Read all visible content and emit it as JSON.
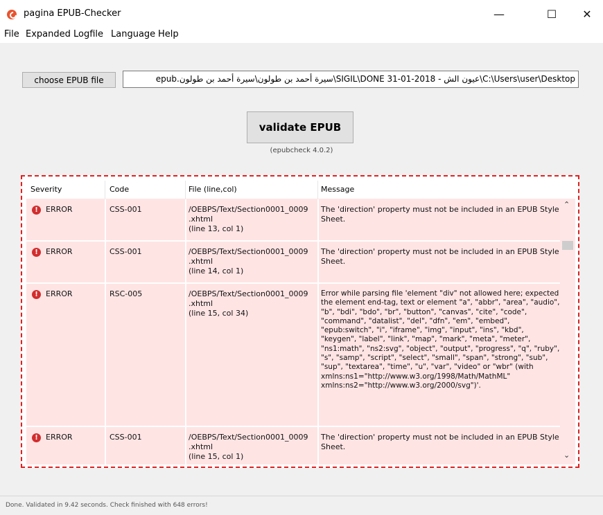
{
  "window": {
    "title": "pagina EPUB-Checker"
  },
  "menu": [
    "File",
    "Expanded",
    "Logfile",
    "Language",
    "Help"
  ],
  "choose_button": "choose EPUB file",
  "path_value": "C:\\Users\\user\\Desktop\\عيون الش - SIGIL\\DONE 31-01-2018\\سيرة أحمد بن طولون\\سيرة أحمد بن طولون.epub",
  "validate_button": "validate EPUB",
  "version": "(epubcheck 4.0.2)",
  "table": {
    "columns": [
      "Severity",
      "Code",
      "File (line,col)",
      "Message"
    ],
    "rows": [
      {
        "severity": "ERROR",
        "code": "CSS-001",
        "file": "/OEBPS/Text/Section0001_0009\n.xhtml\n(line 13, col 1)",
        "message": "The 'direction' property must not be included in an EPUB Style Sheet."
      },
      {
        "severity": "ERROR",
        "code": "CSS-001",
        "file": "/OEBPS/Text/Section0001_0009\n.xhtml\n(line 14, col 1)",
        "message": "The 'direction' property must not be included in an EPUB Style Sheet."
      },
      {
        "severity": "ERROR",
        "code": "RSC-005",
        "file": "/OEBPS/Text/Section0001_0009\n.xhtml\n(line 15, col 34)",
        "message": "Error while parsing file 'element \"div\" not allowed here; expected the element end-tag, text or element \"a\", \"abbr\", \"area\", \"audio\", \"b\", \"bdi\", \"bdo\", \"br\", \"button\", \"canvas\", \"cite\", \"code\", \"command\", \"datalist\", \"del\", \"dfn\", \"em\", \"embed\", \"epub:switch\", \"i\", \"iframe\", \"img\", \"input\", \"ins\", \"kbd\", \"keygen\", \"label\", \"link\", \"map\", \"mark\", \"meta\", \"meter\", \"ns1:math\", \"ns2:svg\", \"object\", \"output\", \"progress\", \"q\", \"ruby\", \"s\", \"samp\", \"script\", \"select\", \"small\", \"span\", \"strong\", \"sub\", \"sup\", \"textarea\", \"time\", \"u\", \"var\", \"video\" or \"wbr\" (with xmlns:ns1=\"http://www.w3.org/1998/Math/MathML\" xmlns:ns2=\"http://www.w3.org/2000/svg\")'."
      },
      {
        "severity": "ERROR",
        "code": "CSS-001",
        "file": "/OEBPS/Text/Section0001_0009\n.xhtml\n(line 15, col 1)",
        "message": "The 'direction' property must not be included in an EPUB Style Sheet."
      }
    ]
  },
  "status": "Done. Validated in 9.42 seconds. Check finished with 648 errors!"
}
